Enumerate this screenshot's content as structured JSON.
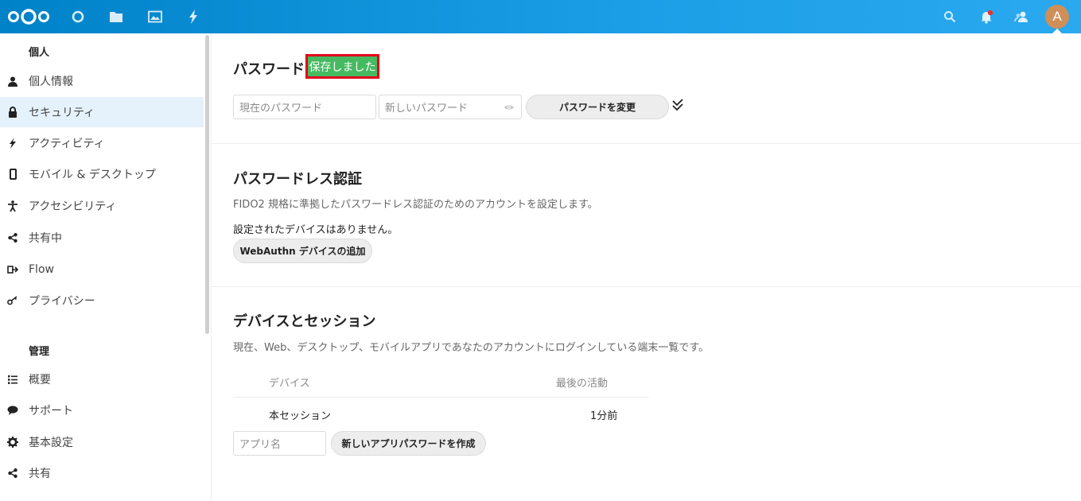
{
  "header": {
    "apps": [
      {
        "name": "nextcloud-logo-icon"
      },
      {
        "name": "dashboard-circle-icon"
      },
      {
        "name": "files-folder-icon"
      },
      {
        "name": "photos-image-icon"
      },
      {
        "name": "activity-bolt-icon"
      }
    ],
    "right_icons": [
      "search-icon",
      "notifications-bell-icon",
      "contacts-icon"
    ],
    "avatar_initial": "A",
    "colors": {
      "bar": "#0082c9",
      "avatar": "#d08f58"
    }
  },
  "sidebar": {
    "personal_heading": "個人",
    "personal_items": [
      {
        "label": "個人情報",
        "icon": "user-icon"
      },
      {
        "label": "セキュリティ",
        "icon": "lock-icon",
        "active": true
      },
      {
        "label": "アクティビティ",
        "icon": "bolt-icon"
      },
      {
        "label": "モバイル & デスクトップ",
        "icon": "phone-icon"
      },
      {
        "label": "アクセシビリティ",
        "icon": "accessibility-icon"
      },
      {
        "label": "共有中",
        "icon": "share-icon"
      },
      {
        "label": "Flow",
        "icon": "flow-icon"
      },
      {
        "label": "プライバシー",
        "icon": "key-icon"
      }
    ],
    "admin_heading": "管理",
    "admin_items": [
      {
        "label": "概要",
        "icon": "list-icon"
      },
      {
        "label": "サポート",
        "icon": "chat-bubble-icon"
      },
      {
        "label": "基本設定",
        "icon": "gear-icon"
      },
      {
        "label": "共有",
        "icon": "share-icon"
      }
    ]
  },
  "password": {
    "title": "パスワード",
    "saved_badge": "保存しました",
    "current_placeholder": "現在のパスワード",
    "new_placeholder": "新しいパスワード",
    "change_button": "パスワードを変更"
  },
  "passwordless": {
    "title": "パスワードレス認証",
    "description": "FIDO2 規格に準拠したパスワードレス認証のためのアカウントを設定します。",
    "no_devices": "設定されたデバイスはありません。",
    "add_button": "WebAuthn デバイスの追加"
  },
  "sessions": {
    "title": "デバイスとセッション",
    "description": "現在、Web、デスクトップ、モバイルアプリであなたのアカウントにログインしている端末一覧です。",
    "columns": [
      "デバイス",
      "最後の活動"
    ],
    "rows": [
      {
        "device": "本セッション",
        "last_activity": "1分前"
      }
    ],
    "app_name_placeholder": "アプリ名",
    "create_button": "新しいアプリパスワードを作成"
  }
}
